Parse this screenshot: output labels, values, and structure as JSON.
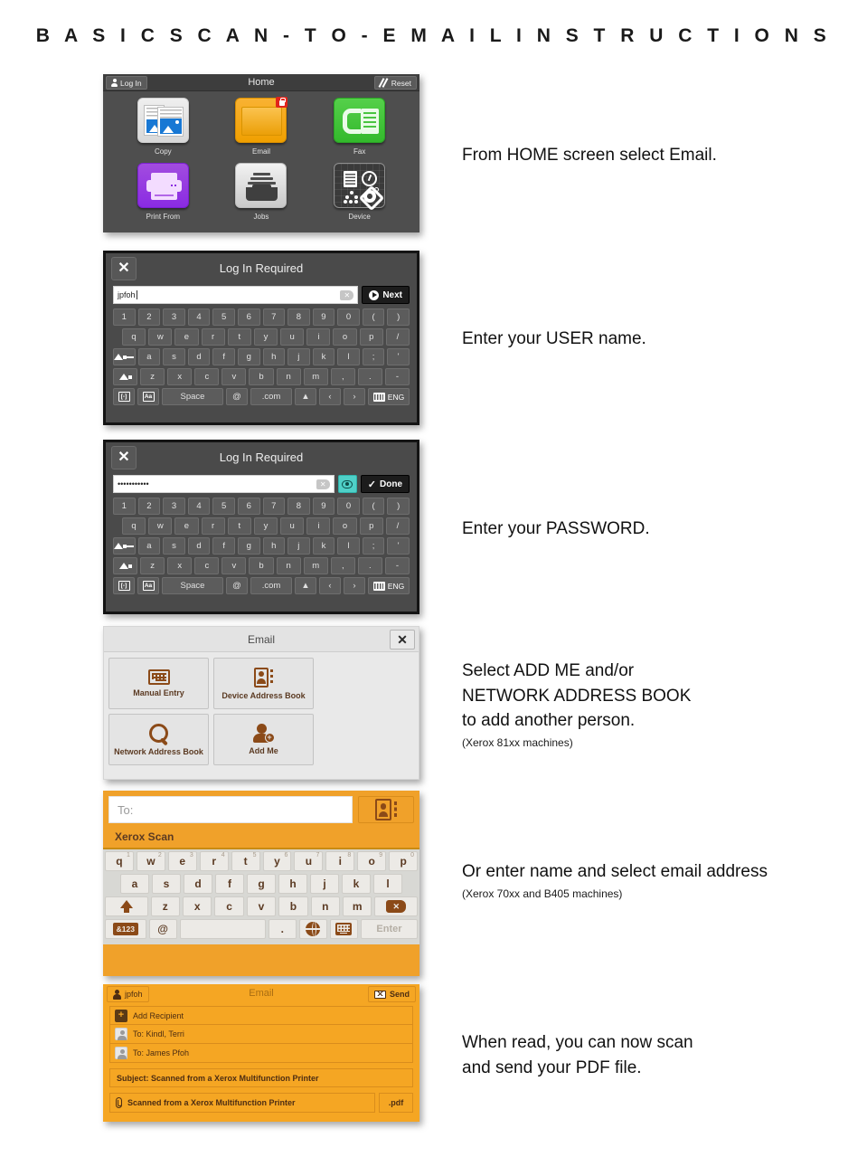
{
  "document": {
    "title": "B A S I C   S C A N - T O - E M A I L   I N S T R U C T I O N S"
  },
  "instructions": [
    {
      "id": "step-1",
      "text": "From HOME screen select Email.",
      "note": ""
    },
    {
      "id": "step-2",
      "text": "Enter your USER name.",
      "note": ""
    },
    {
      "id": "step-3",
      "text": "Enter your PASSWORD.",
      "note": ""
    },
    {
      "id": "step-4",
      "line1": "Select ADD ME and/or",
      "line2": "NETWORK ADDRESS BOOK",
      "line3": "to add another person.",
      "note": "(Xerox 81xx machines)"
    },
    {
      "id": "step-5",
      "text": "Or enter name and select email address",
      "note": "(Xerox 70xx and B405 machines)"
    },
    {
      "id": "step-6",
      "line1": "When read, you can now scan",
      "line2": "and send your PDF file.",
      "note": ""
    }
  ],
  "home_screen": {
    "title": "Home",
    "login_label": "Log In",
    "reset_label": "Reset",
    "tiles": [
      {
        "label": "Copy",
        "icon": "copy-icon",
        "color": "#dcdcdc",
        "badge": null
      },
      {
        "label": "Email",
        "icon": "envelope-icon",
        "color": "#f0a000",
        "badge": "lock-badge"
      },
      {
        "label": "Fax",
        "icon": "fax-icon",
        "color": "#33b92c",
        "badge": null
      },
      {
        "label": "Print From",
        "icon": "printer-icon",
        "color": "#8a2be2",
        "badge": null
      },
      {
        "label": "Jobs",
        "icon": "jobs-tray-icon",
        "color": "#c9c9c9",
        "badge": null
      },
      {
        "label": "Device",
        "icon": "device-icon",
        "color": "#3a3a3a",
        "badge": null
      }
    ]
  },
  "login_username": {
    "title": "Log In Required",
    "close_label": "✕",
    "input_value": "jpfoh",
    "action_label": "Next",
    "keyboard": {
      "row1": [
        "1",
        "2",
        "3",
        "4",
        "5",
        "6",
        "7",
        "8",
        "9",
        "0",
        "(",
        ")"
      ],
      "row2": [
        "q",
        "w",
        "e",
        "r",
        "t",
        "y",
        "u",
        "i",
        "o",
        "p",
        "/"
      ],
      "row3": [
        "a",
        "s",
        "d",
        "f",
        "g",
        "h",
        "j",
        "k",
        "l",
        ";",
        "'"
      ],
      "row4": [
        "z",
        "x",
        "c",
        "v",
        "b",
        "n",
        "m",
        ",",
        ".",
        "-"
      ],
      "caps_lock_label": "caps-lock",
      "shift_label": "shift",
      "symbols_label": "[-]",
      "accent_label": "Aa",
      "space_label": "Space",
      "at_label": "@",
      "dotcom_label": ".com",
      "up_label": "▲",
      "prev_label": "‹",
      "next_label": "›",
      "lang_label": "ENG"
    }
  },
  "login_password": {
    "title": "Log In Required",
    "close_label": "✕",
    "input_value": "•••••••••••",
    "show_password_icon": "eye-icon",
    "action_label": "Done"
  },
  "email_sources": {
    "title": "Email",
    "close_label": "✕",
    "cards": [
      {
        "label": "Manual Entry",
        "icon": "keyboard-icon"
      },
      {
        "label": "Device Address Book",
        "icon": "address-book-icon"
      },
      {
        "label": "Network Address Book",
        "icon": "search-icon"
      },
      {
        "label": "Add Me",
        "icon": "add-person-icon"
      }
    ]
  },
  "scan_keyboard": {
    "to_placeholder": "To:",
    "address_book_icon": "address-book-icon",
    "brand_label": "Xerox Scan",
    "row1": [
      {
        "k": "q",
        "s": "1"
      },
      {
        "k": "w",
        "s": "2"
      },
      {
        "k": "e",
        "s": "3"
      },
      {
        "k": "r",
        "s": "4"
      },
      {
        "k": "t",
        "s": "5"
      },
      {
        "k": "y",
        "s": "6"
      },
      {
        "k": "u",
        "s": "7"
      },
      {
        "k": "i",
        "s": "8"
      },
      {
        "k": "o",
        "s": "9"
      },
      {
        "k": "p",
        "s": "0"
      }
    ],
    "row2": [
      "a",
      "s",
      "d",
      "f",
      "g",
      "h",
      "j",
      "k",
      "l"
    ],
    "row3": [
      "z",
      "x",
      "c",
      "v",
      "b",
      "n",
      "m"
    ],
    "shift_label": "shift",
    "delete_label": "delete",
    "num_label": "&123",
    "at_label": "@",
    "period_label": ".",
    "globe_label": "globe",
    "keyboard_label": "keyboard",
    "enter_label": "Enter"
  },
  "compose": {
    "user_label": "jpfoh",
    "title": "Email",
    "send_label": "Send",
    "rows": [
      {
        "icon": "plus-icon",
        "text": "Add Recipient"
      },
      {
        "icon": "avatar-icon",
        "text": "To: Kindl, Terri"
      },
      {
        "icon": "avatar-icon",
        "text": "To: James Pfoh"
      }
    ],
    "subject": "Subject: Scanned from a Xerox Multifunction Printer",
    "attachment_name": "Scanned from a Xerox Multifunction Printer",
    "attachment_ext": ".pdf"
  },
  "colors": {
    "xerox_orange": "#f5a623",
    "scan_orange": "#f0a12a",
    "brown": "#8b4a18",
    "dark_panel": "#4a4a4a",
    "email_tile": "#f0a000",
    "fax_green": "#33b92c",
    "print_purple": "#8a2be2",
    "badge_red": "#e1251b",
    "teal_eye": "#4fd0c8"
  }
}
